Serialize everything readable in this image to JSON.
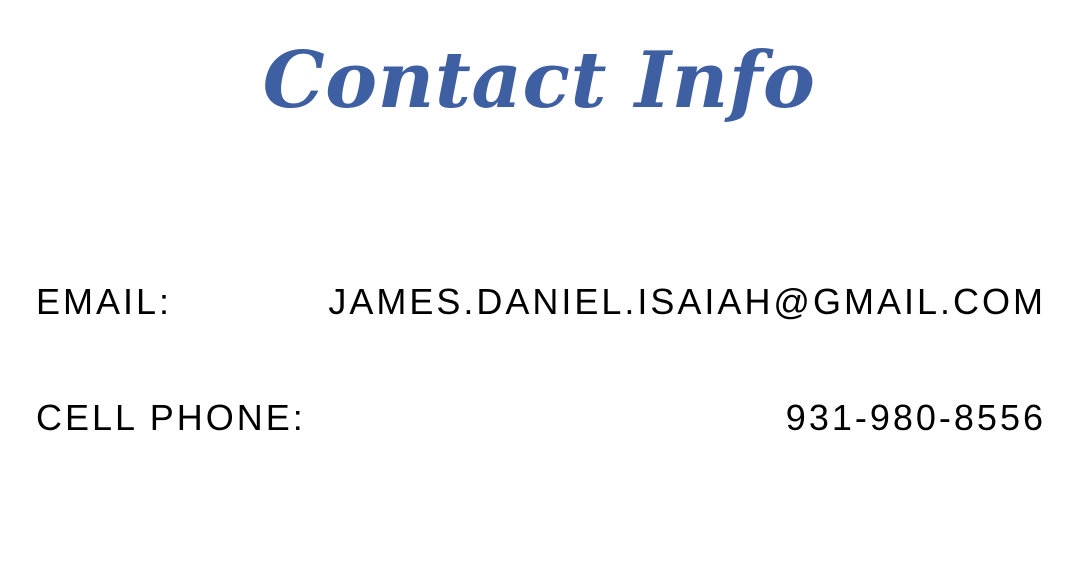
{
  "colors": {
    "title": "#3f5fa3",
    "text": "#000000",
    "background": "#ffffff"
  },
  "title": "Contact Info",
  "contacts": [
    {
      "label": "email:",
      "value": "james.daniel.isaiah@gmail.com"
    },
    {
      "label": "cell phone:",
      "value": "931-980-8556"
    }
  ]
}
